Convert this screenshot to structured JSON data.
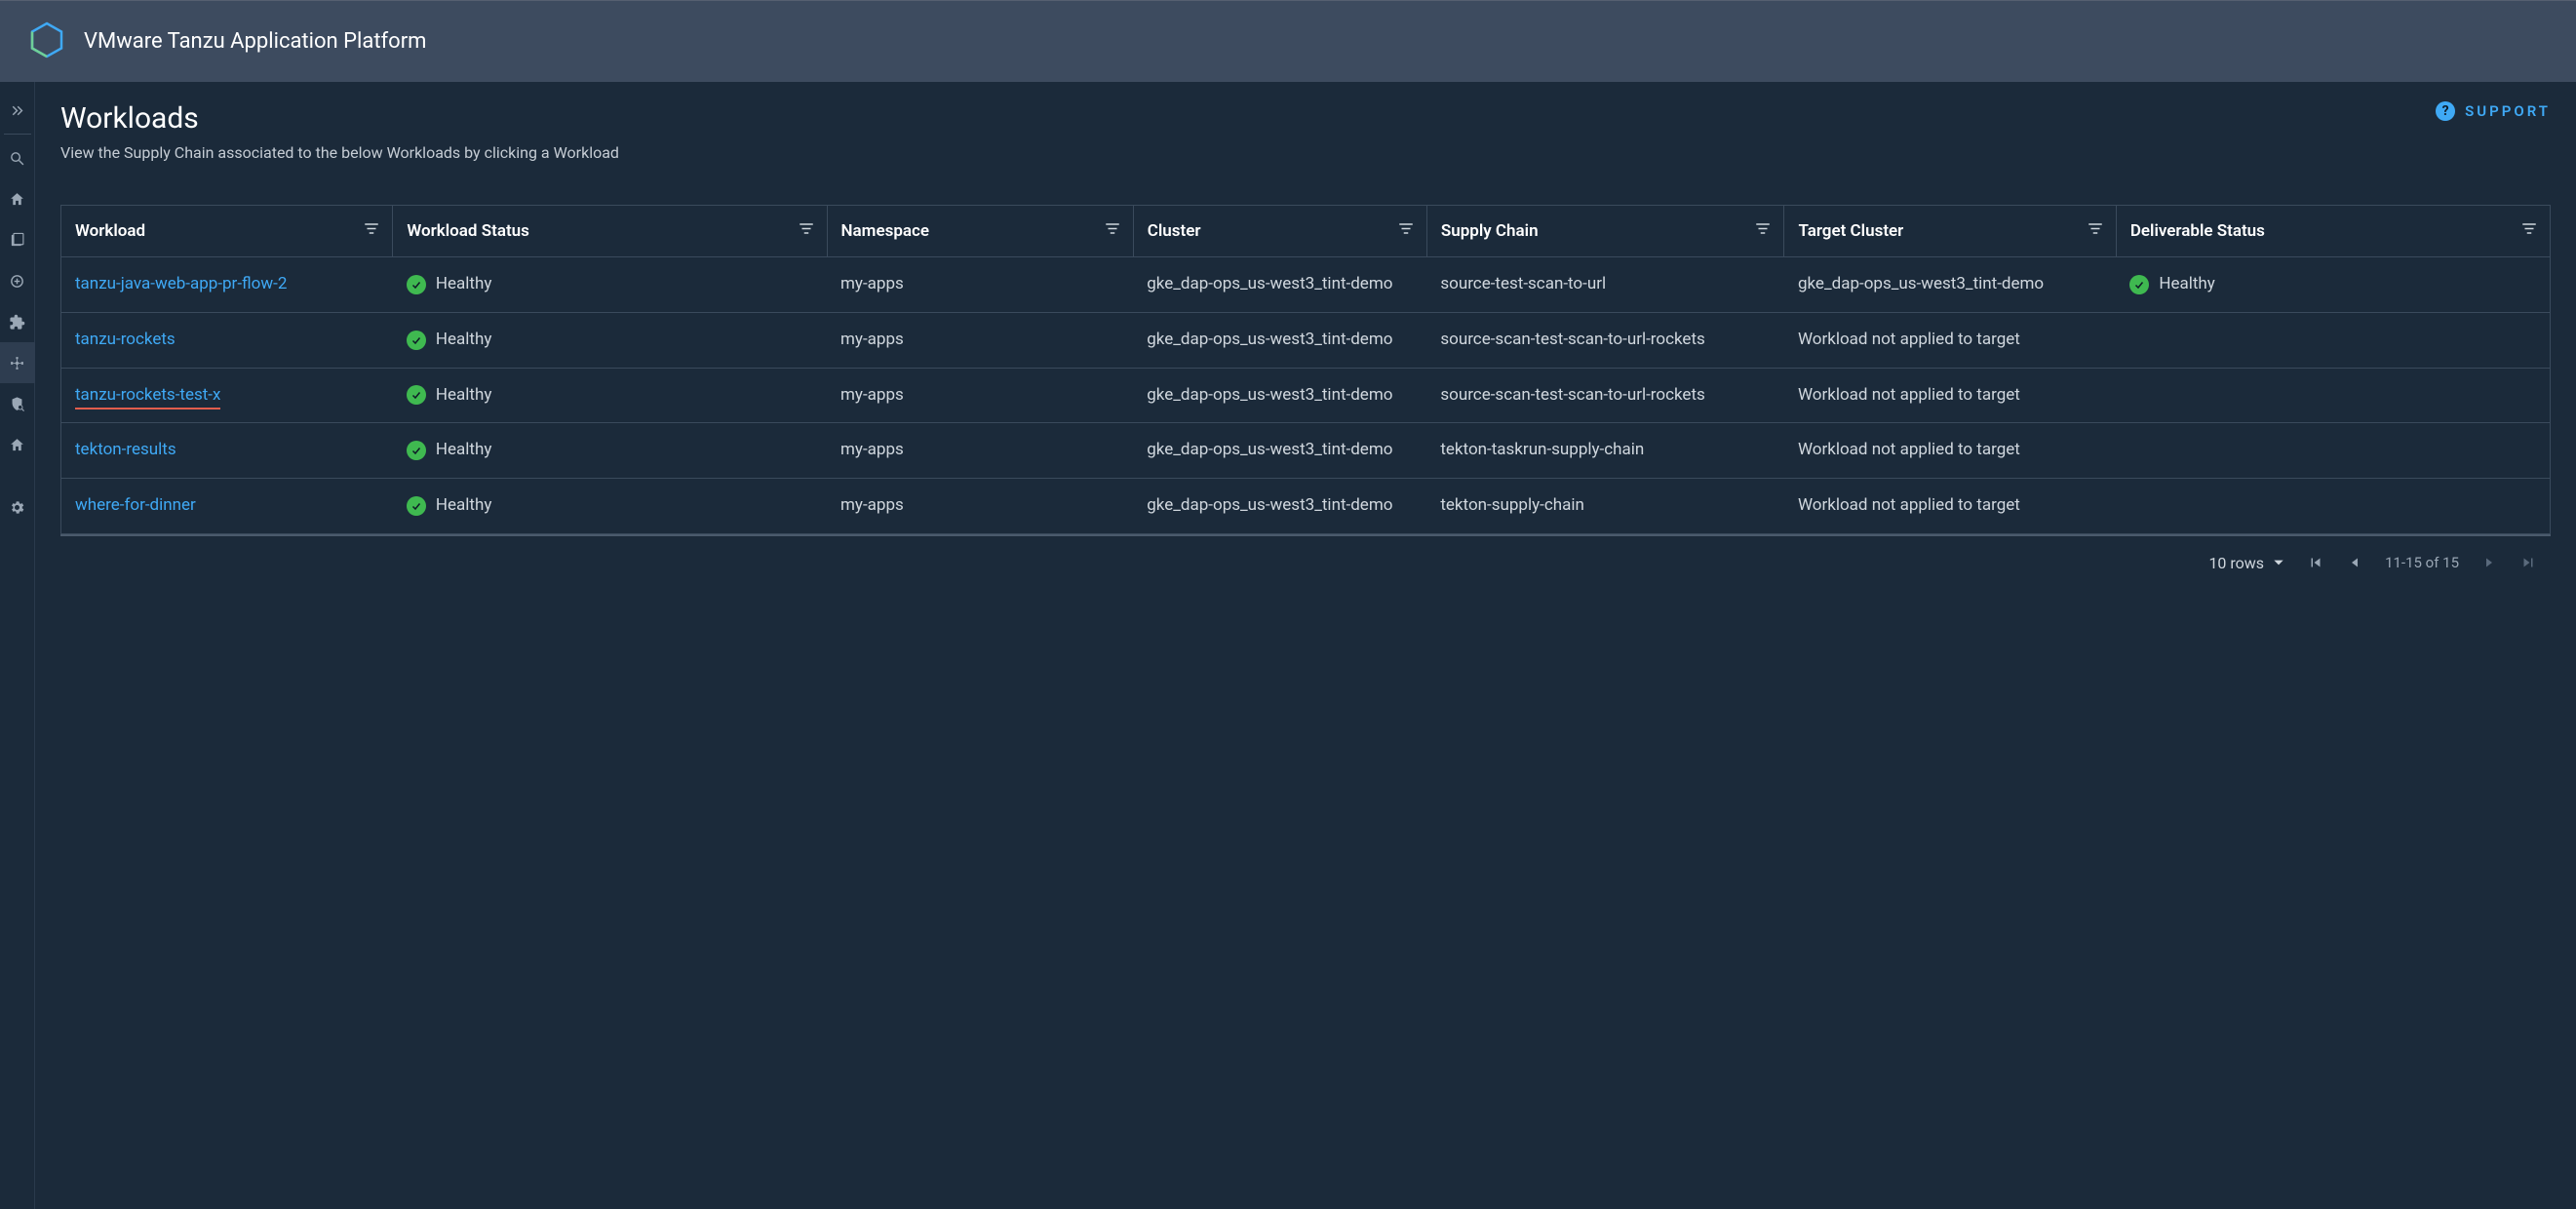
{
  "app_title": "VMware Tanzu Application Platform",
  "page": {
    "title": "Workloads",
    "subtitle": "View the Supply Chain associated to the below Workloads by clicking a Workload",
    "support_label": "SUPPORT"
  },
  "columns": {
    "workload": "Workload",
    "workload_status": "Workload Status",
    "namespace": "Namespace",
    "cluster": "Cluster",
    "supply_chain": "Supply Chain",
    "target_cluster": "Target Cluster",
    "deliverable_status": "Deliverable Status"
  },
  "rows": [
    {
      "workload": "tanzu-java-web-app-pr-flow-2",
      "workload_underlined": false,
      "workload_status": "Healthy",
      "namespace": "my-apps",
      "cluster": "gke_dap-ops_us-west3_tint-demo",
      "supply_chain": "source-test-scan-to-url",
      "target_cluster": "gke_dap-ops_us-west3_tint-demo",
      "deliverable_status": "Healthy",
      "deliverable_ok": true
    },
    {
      "workload": "tanzu-rockets",
      "workload_underlined": false,
      "workload_status": "Healthy",
      "namespace": "my-apps",
      "cluster": "gke_dap-ops_us-west3_tint-demo",
      "supply_chain": "source-scan-test-scan-to-url-rockets",
      "target_cluster": "Workload not applied to target",
      "deliverable_status": "",
      "deliverable_ok": false
    },
    {
      "workload": "tanzu-rockets-test-x",
      "workload_underlined": true,
      "workload_status": "Healthy",
      "namespace": "my-apps",
      "cluster": "gke_dap-ops_us-west3_tint-demo",
      "supply_chain": "source-scan-test-scan-to-url-rockets",
      "target_cluster": "Workload not applied to target",
      "deliverable_status": "",
      "deliverable_ok": false
    },
    {
      "workload": "tekton-results",
      "workload_underlined": false,
      "workload_status": "Healthy",
      "namespace": "my-apps",
      "cluster": "gke_dap-ops_us-west3_tint-demo",
      "supply_chain": "tekton-taskrun-supply-chain",
      "target_cluster": "Workload not applied to target",
      "deliverable_status": "",
      "deliverable_ok": false
    },
    {
      "workload": "where-for-dinner",
      "workload_underlined": false,
      "workload_status": "Healthy",
      "namespace": "my-apps",
      "cluster": "gke_dap-ops_us-west3_tint-demo",
      "supply_chain": "tekton-supply-chain",
      "target_cluster": "Workload not applied to target",
      "deliverable_status": "",
      "deliverable_ok": false
    }
  ],
  "pagination": {
    "rows_label": "10 rows",
    "range_label": "11-15 of 15"
  }
}
